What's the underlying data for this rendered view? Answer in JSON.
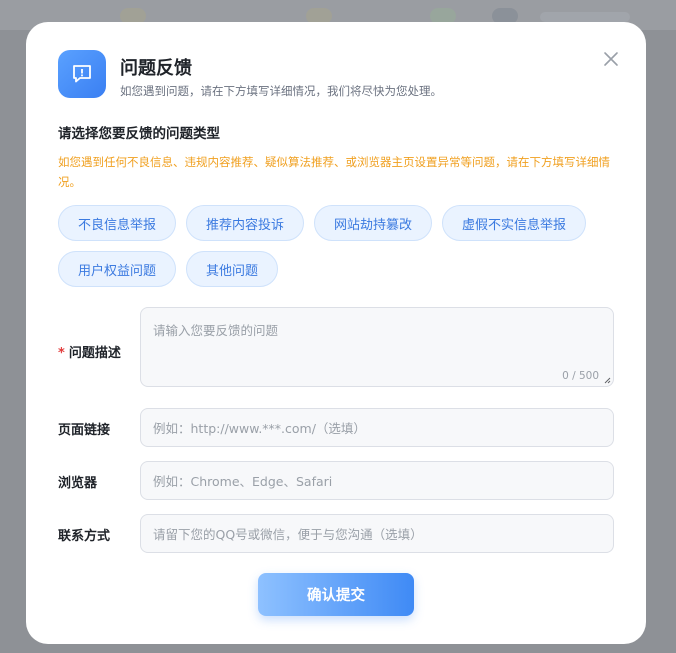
{
  "dialog": {
    "title": "问题反馈",
    "subtitle": "如您遇到问题，请在下方填写详细情况，我们将尽快为您处理。"
  },
  "category": {
    "heading": "请选择您要反馈的问题类型",
    "notice": "如您遇到任何不良信息、违规内容推荐、疑似算法推荐、或浏览器主页设置异常等问题，请在下方填写详细情况。",
    "options": [
      {
        "label": "不良信息举报"
      },
      {
        "label": "推荐内容投诉"
      },
      {
        "label": "网站劫持篡改"
      },
      {
        "label": "虚假不实信息举报"
      },
      {
        "label": "用户权益问题"
      },
      {
        "label": "其他问题"
      }
    ]
  },
  "form": {
    "required_mark": "*",
    "description": {
      "label": "问题描述",
      "placeholder": "请输入您要反馈的问题",
      "counter": "0 / 500"
    },
    "page_link": {
      "label": "页面链接",
      "placeholder": "例如：http://www.***.com/（选填）"
    },
    "browser": {
      "label": "浏览器",
      "placeholder": "例如：Chrome、Edge、Safari"
    },
    "contact": {
      "label": "联系方式",
      "placeholder": "请留下您的QQ号或微信，便于与您沟通（选填）"
    }
  },
  "submit_label": "确认提交",
  "icons": {
    "header": "feedback-message-icon",
    "close": "close-icon"
  },
  "colors": {
    "accent": "#3b7ae0",
    "required": "#e23b3b",
    "notice": "#f0a020"
  }
}
